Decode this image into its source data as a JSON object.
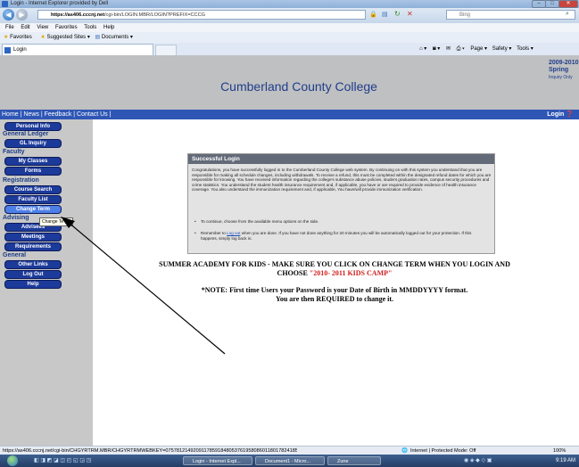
{
  "browser": {
    "window_title": "Login - Internet Explorer provided by Dell",
    "url_domain": "https://as406.cccnj.net",
    "url_path": "/cgi-bin/LOGIN.MBR/LOGIN?PREFIX=CCCG",
    "search_placeholder": "Bing",
    "menu": [
      "File",
      "Edit",
      "View",
      "Favorites",
      "Tools",
      "Help"
    ],
    "favorites": {
      "label": "Favorites",
      "suggested": "Suggested Sites ▾",
      "documents": "Documents ▾"
    },
    "tab_title": "Login",
    "commands": [
      "Page ▾",
      "Safety ▾",
      "Tools ▾"
    ]
  },
  "site": {
    "title": "Cumberland County College",
    "term": {
      "years": "2009-2010",
      "season": "Spring",
      "note": "Inquiry Only"
    },
    "top_nav": "Home | News | Feedback | Contact Us |",
    "login_label": "Login"
  },
  "sidebar": {
    "personal_info": "Personal Info",
    "general_ledger": {
      "heading": "General Ledger",
      "items": [
        "GL Inquiry"
      ]
    },
    "faculty": {
      "heading": "Faculty",
      "items": [
        "My Classes",
        "Forms"
      ]
    },
    "registration": {
      "heading": "Registration",
      "items": [
        "Course Search",
        "Faculty List",
        "Change Term"
      ]
    },
    "advising": {
      "heading": "Advising",
      "items": [
        "Advisees",
        "Meetings",
        "Requirements"
      ]
    },
    "general": {
      "heading": "General",
      "items": [
        "Other Links",
        "Log Out",
        "Help"
      ]
    },
    "tooltip": "Change Te"
  },
  "main": {
    "success_title": "Successful Login",
    "success_body": "Congratulations, you have successfully logged in to the Cumberland County College web system. By continuing on with this system you understand that you are responsible for making all schedule changes, including withdrawals. To receive a refund, this must be completed within the designated refund dates for which you are responsible for knowing. You have received information regarding the college's substance abuse policies, student graduation rates, campus security procedures and crime statistics. You understand the student health insurance requirement and, if applicable, you have or are required to provide evidence of health insurance coverage. You also understand the immunization requirement and, if applicable, You have/will provide immunization verification.",
    "bullet1": "To continue, choose from the available menu options on the side.",
    "bullet2_pre": "Remember to",
    "bullet2_link": "Log out",
    "bullet2_post": "when you are done. If you have not done anything for 20 minutes you will be automatically logged out for your protection. If this happens, simply log back in.",
    "summer_line1": "SUMMER ACADEMY FOR KIDS - MAKE SURE YOU CLICK ON CHANGE TERM WHEN YOU LOGIN AND",
    "summer_choose": "CHOOSE",
    "summer_highlight": "\"2010- 2011 KIDS CAMP\"",
    "note_line1": "*NOTE: First time Users your Password is your Date of Birth in MMDDYYYY format.",
    "note_line2": "You are then REQUIRED to change it."
  },
  "status": {
    "url": "https://as406.cccnj.net/cgi-bin/CHGYRTRM.MBR/CHGYRTRMWEBKEY=075781214920911785918480537619580860118017824185​60",
    "zone": "Internet | Protected Mode: Off",
    "zoom": "100%"
  },
  "taskbar": {
    "tasks": [
      "Login - Internet Expl...",
      "Document1 - Micro...",
      "Zune"
    ],
    "clock": "9:19 AM"
  },
  "colors": {
    "header_bg": "#bfc0c2",
    "nav_bg": "#2f56b5",
    "button_bg": "#1c3a9a",
    "highlight_red": "#d21d1d"
  }
}
